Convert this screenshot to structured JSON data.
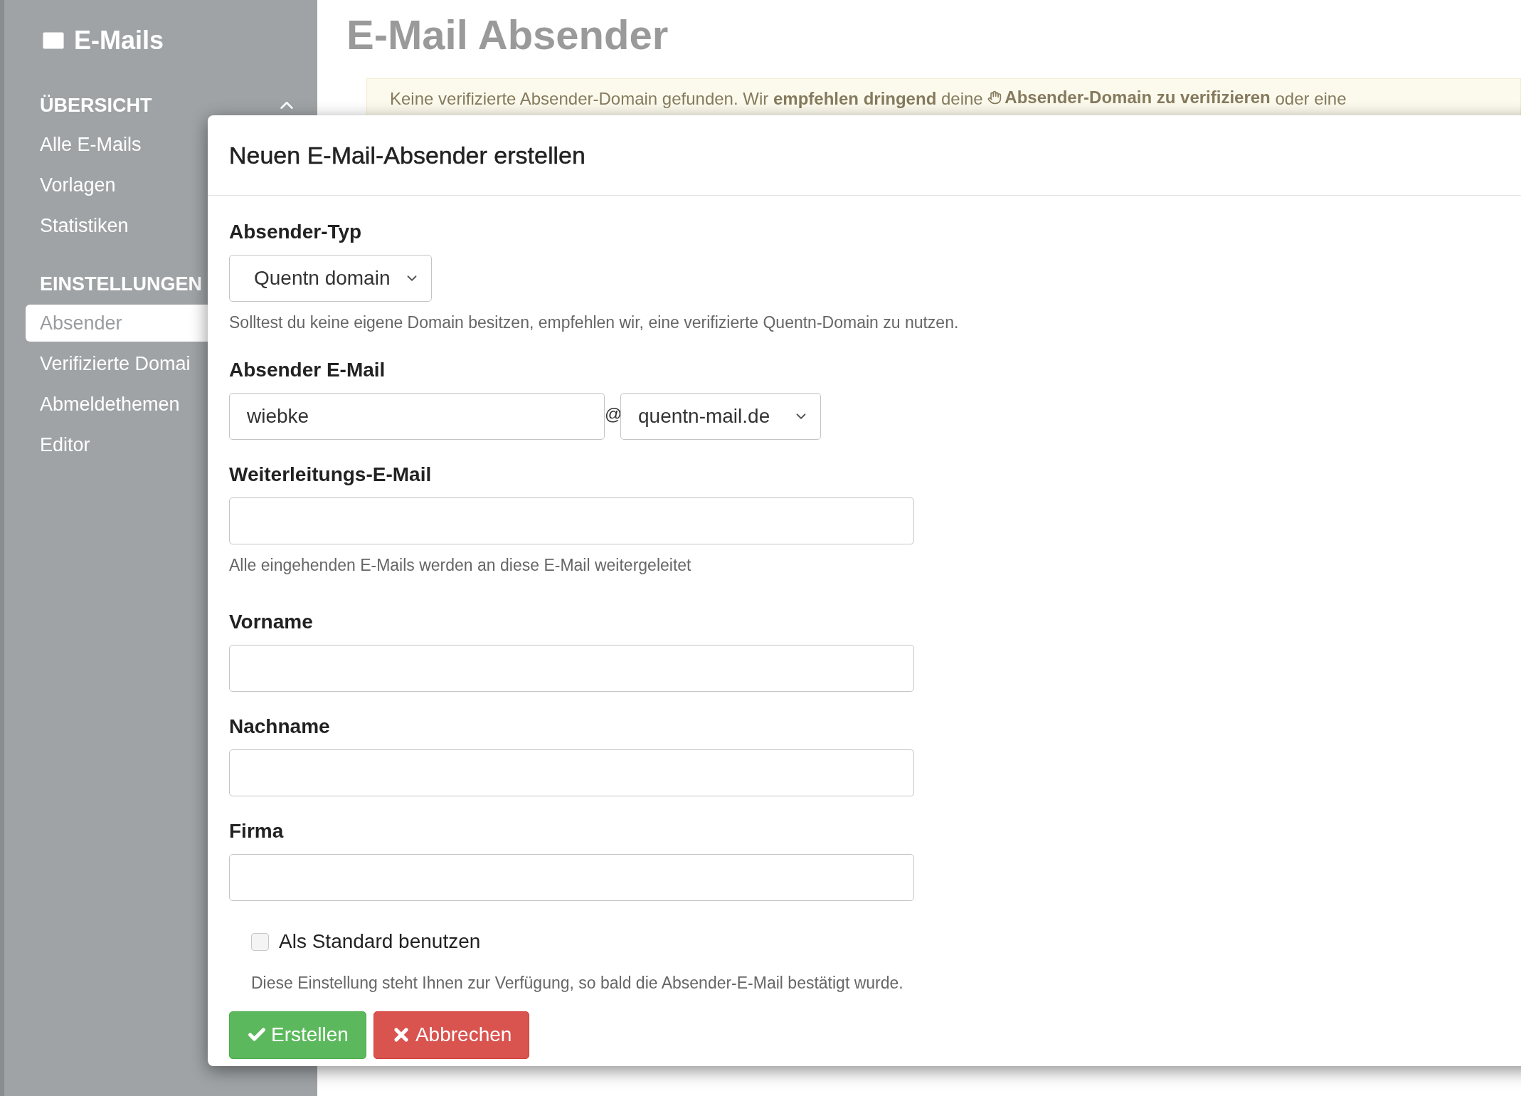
{
  "sidebar": {
    "title": "E-Mails",
    "sections": [
      {
        "heading": "ÜBERSICHT",
        "expanded": true,
        "items": [
          {
            "label": "Alle E-Mails",
            "selected": false
          },
          {
            "label": "Vorlagen",
            "selected": false
          },
          {
            "label": "Statistiken",
            "selected": false
          }
        ]
      },
      {
        "heading": "EINSTELLUNGEN",
        "items": [
          {
            "label": "Absender",
            "selected": true
          },
          {
            "label": "Verifizierte Domai",
            "selected": false
          },
          {
            "label": "Abmeldethemen",
            "selected": false
          },
          {
            "label": "Editor",
            "selected": false
          }
        ]
      }
    ]
  },
  "page": {
    "title": "E-Mail Absender",
    "alert": {
      "text": "Keine verifizierte Absender-Domain gefunden. Wir **empfehlen dringend** deine",
      "link": "Absender-Domain zu verifizieren",
      "rest": "oder eine"
    }
  },
  "dialog": {
    "title": "Neuen E-Mail-Absender erstellen",
    "fields": [
      {
        "kind": "select",
        "label": "Absender-Typ",
        "value": "Quentn domain",
        "help": "Solltest du keine eigene Domain besitzen, empfehlen wir, eine verifizierte Quentn-Domain zu nutzen."
      },
      {
        "kind": "email",
        "label": "Absender E-Mail",
        "value": "wiebke",
        "separator": "@",
        "domain": "quentn-mail.de"
      },
      {
        "kind": "text",
        "label": "Weiterleitungs-E-Mail",
        "help": "Alle eingehenden E-Mails werden an diese E-Mail weitergeleitet"
      },
      {
        "kind": "text",
        "label": "Vorname"
      },
      {
        "kind": "text",
        "label": "Nachname"
      },
      {
        "kind": "text",
        "label": "Firma"
      }
    ],
    "checkbox": {
      "label": "Als Standard benutzen",
      "checked": false,
      "help": "Diese Einstellung steht Ihnen zur Verfügung, so bald die Absender-E-Mail bestätigt wurde."
    },
    "buttons": [
      {
        "kind": "confirm",
        "label": "Erstellen"
      },
      {
        "kind": "cancel",
        "label": "Abbrechen"
      }
    ]
  }
}
